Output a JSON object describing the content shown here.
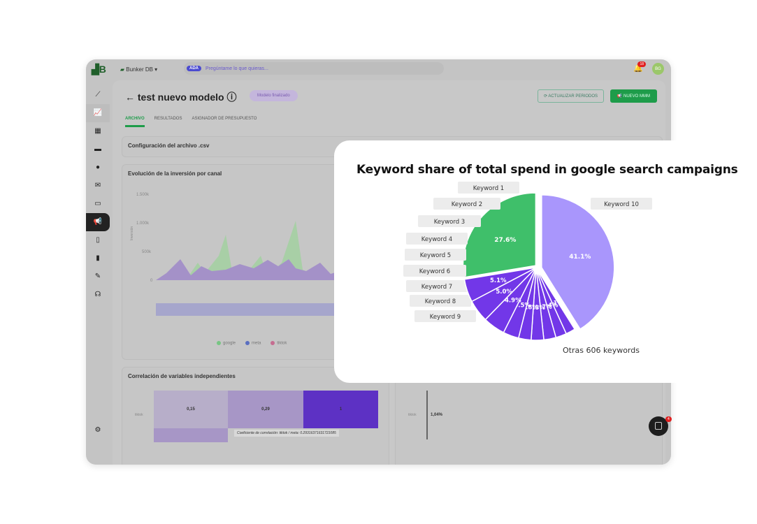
{
  "app": {
    "workspace": "Bunker DB",
    "ask_badge": "ADA",
    "ask_placeholder": "Pregúntame lo que quieras...",
    "notifications": "18",
    "avatar_initials": "BG",
    "page_title": "test nuevo modelo",
    "status_pill": "Modelo finalizado",
    "btn_update": "ACTUALIZAR PERIODOS",
    "btn_new": "NUEVO MMM",
    "tabs": [
      "ARCHIVO",
      "RESULTADOS",
      "ASIGNADOR DE PRESUPUESTO"
    ],
    "panel_config": "Configuración del archivo .csv",
    "panel_evolution": "Evolución de la inversión por canal",
    "evolution_yticks": [
      "1.500k",
      "1.000k",
      "500k",
      "0"
    ],
    "evolution_ylabel": "Inversión",
    "legend": [
      {
        "name": "google",
        "color": "#4fc46a"
      },
      {
        "name": "meta",
        "color": "#4a60d0"
      },
      {
        "name": "tiktok",
        "color": "#d05080"
      }
    ],
    "panel_corr": "Correlación de variables independientes",
    "corr_row": "tiktok",
    "corr_values": [
      "0,15",
      "0,29",
      "1"
    ],
    "corr_tooltip": "Coeficiente de correlación: tiktok / meta: 0.29316371631721085",
    "right_row": "tiktok",
    "right_value": "1,04%",
    "chat_badge": "4"
  },
  "chart_data": {
    "type": "pie",
    "title": "Keyword share of total spend in google search campaigns",
    "slices": [
      {
        "label": "Keyword 10",
        "value": 27.6,
        "color": "#3fbf6a"
      },
      {
        "label": "Otras 606 keywords",
        "value": 41.1,
        "color": "#a996fc"
      },
      {
        "label": "Keyword 9",
        "value": 2.1,
        "color": "#7237e8"
      },
      {
        "label": "Keyword 8",
        "value": 2.4,
        "color": "#7237e8"
      },
      {
        "label": "Keyword 7",
        "value": 2.7,
        "color": "#7237e8"
      },
      {
        "label": "Keyword 6",
        "value": 2.8,
        "color": "#7237e8"
      },
      {
        "label": "Keyword 5",
        "value": 2.8,
        "color": "#7237e8"
      },
      {
        "label": "Keyword 4",
        "value": 3.5,
        "color": "#7237e8"
      },
      {
        "label": "Keyword 3",
        "value": 4.9,
        "color": "#7237e8"
      },
      {
        "label": "Keyword 2",
        "value": 5.0,
        "color": "#7237e8"
      },
      {
        "label": "Keyword 1",
        "value": 5.1,
        "color": "#7237e8"
      }
    ],
    "value_labels": [
      "27.6%",
      "41.1%",
      "2.1%",
      "2.4%",
      "2.7%",
      "2.8%",
      "2.8%",
      "3.5%",
      "4.9%",
      "5.0%",
      "5.1%"
    ]
  }
}
